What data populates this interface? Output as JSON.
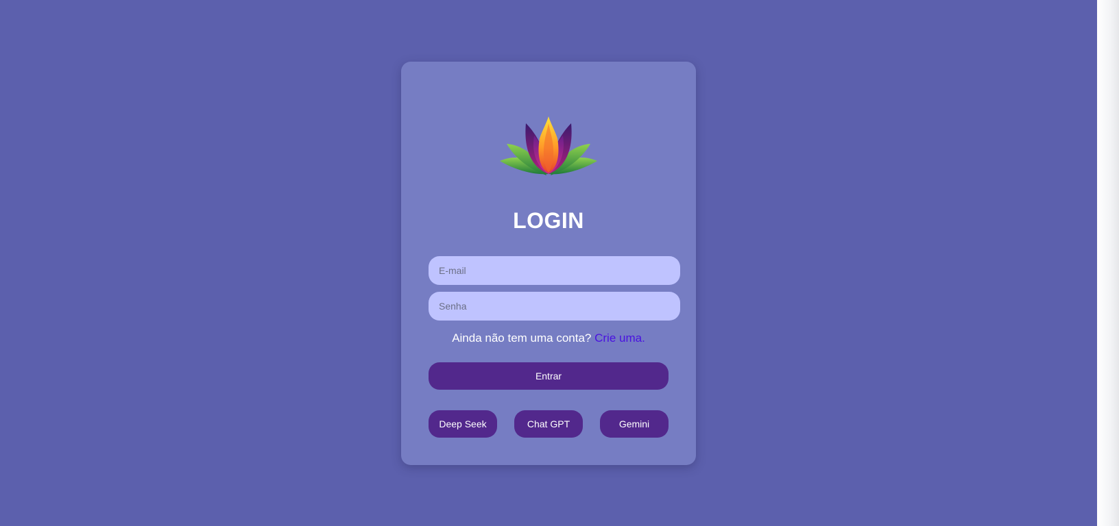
{
  "login": {
    "title": "LOGIN",
    "email_placeholder": "E-mail",
    "password_placeholder": "Senha",
    "signup_prompt": "Ainda não tem uma conta?",
    "signup_link": "Crie uma.",
    "submit_label": "Entrar"
  },
  "ai_buttons": [
    {
      "label": "Deep Seek"
    },
    {
      "label": "Chat GPT"
    },
    {
      "label": "Gemini"
    }
  ],
  "colors": {
    "background": "#5c60ad",
    "card": "#767dc3",
    "input": "#bfc3ff",
    "button": "#52288c",
    "link": "#4a12e0"
  },
  "icons": {
    "logo": "lotus-flower-icon"
  }
}
